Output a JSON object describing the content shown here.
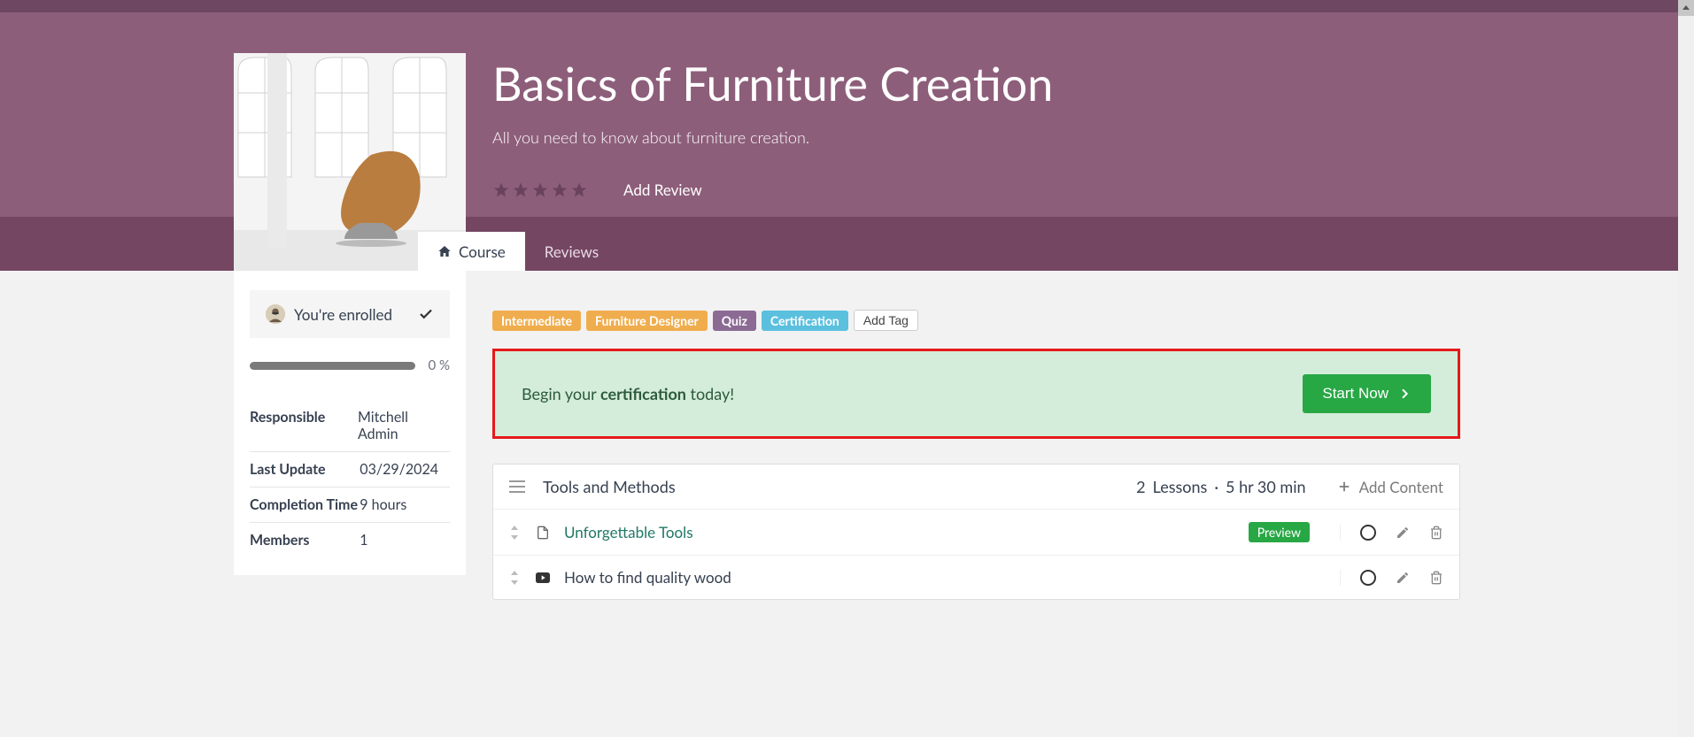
{
  "course": {
    "title": "Basics of Furniture Creation",
    "subtitle": "All you need to know about furniture creation.",
    "add_review_label": "Add Review"
  },
  "tabs": {
    "course": "Course",
    "reviews": "Reviews"
  },
  "sidebar": {
    "enrolled_text": "You're enrolled",
    "progress_pct": "0 %",
    "info": {
      "responsible_label": "Responsible",
      "responsible_value": "Mitchell Admin",
      "last_update_label": "Last Update",
      "last_update_value": "03/29/2024",
      "completion_label": "Completion Time",
      "completion_value": "9 hours",
      "members_label": "Members",
      "members_value": "1"
    }
  },
  "tags": {
    "intermediate": "Intermediate",
    "designer": "Furniture Designer",
    "quiz": "Quiz",
    "certification": "Certification",
    "add_tag": "Add Tag"
  },
  "cert": {
    "prefix": "Begin your ",
    "bold": "certification",
    "suffix": " today!",
    "start_label": "Start Now"
  },
  "section": {
    "title": "Tools and Methods",
    "lessons_count": "2",
    "lessons_label": "Lessons",
    "separator": "·",
    "duration": "5 hr 30 min",
    "add_content_label": "Add Content"
  },
  "lessons": [
    {
      "title": "Unforgettable Tools",
      "preview": "Preview",
      "type": "pdf"
    },
    {
      "title": "How to find quality wood",
      "type": "video"
    }
  ]
}
